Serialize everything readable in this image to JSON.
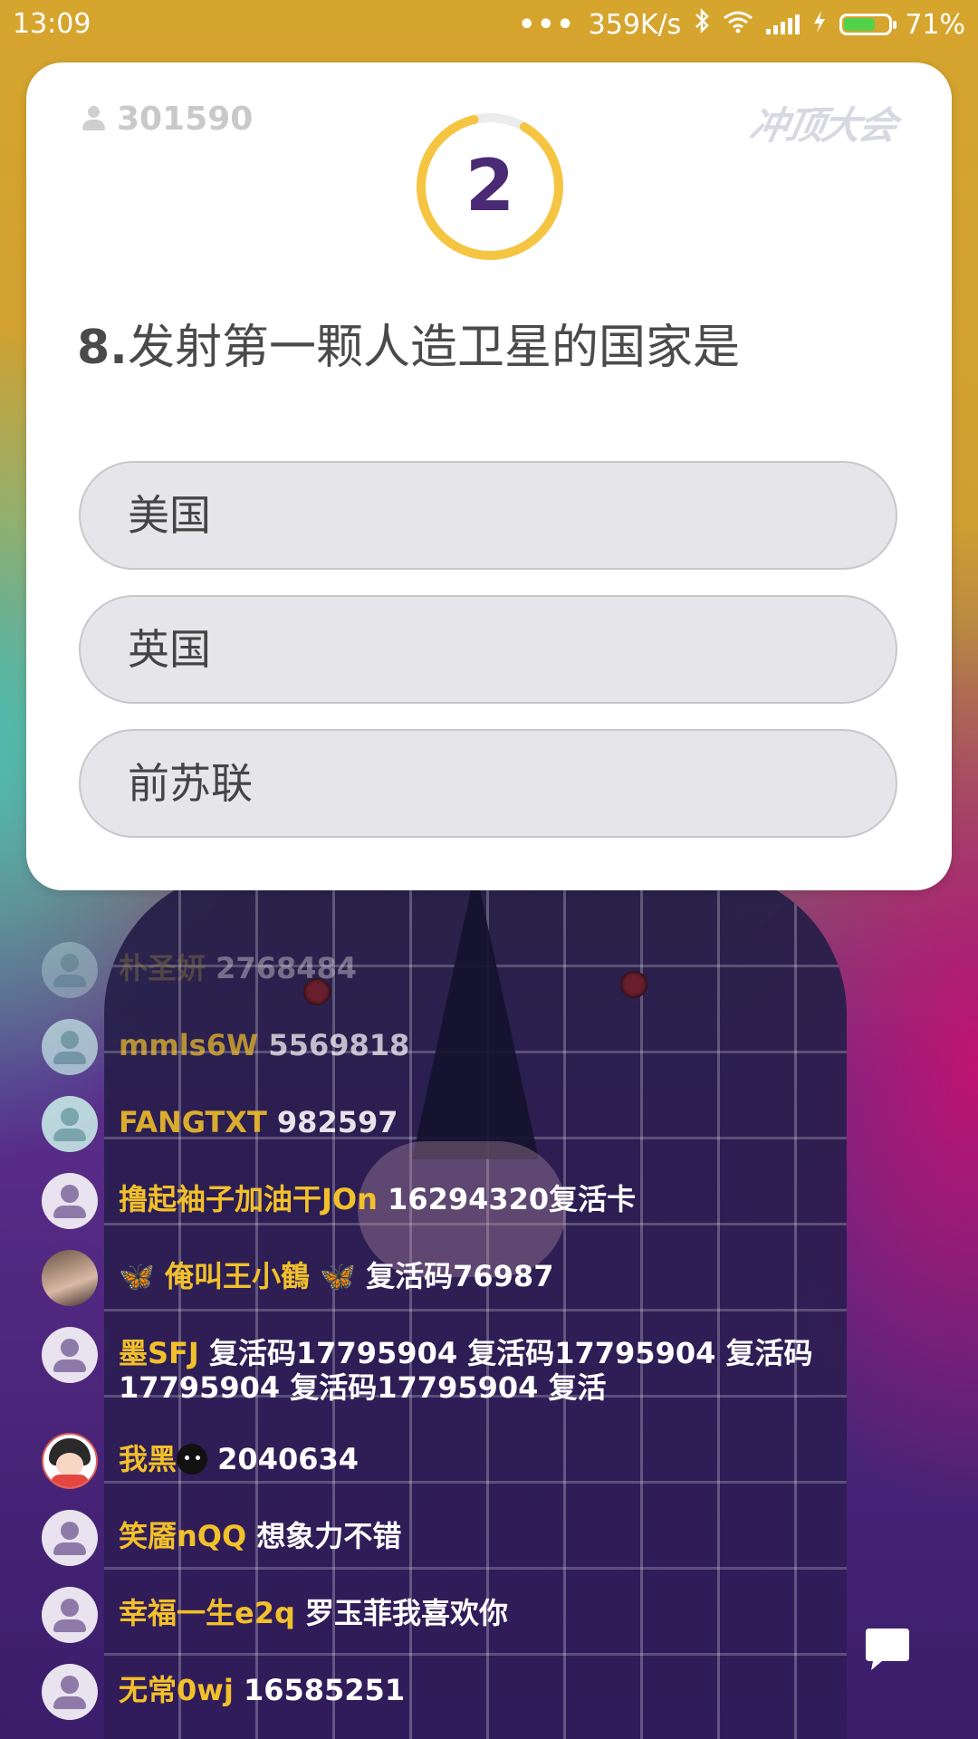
{
  "status_bar": {
    "time": "13:09",
    "network_speed": "359K/s",
    "battery_percent": "71%",
    "battery_level": 0.71,
    "icons": [
      "more-dots-icon",
      "bluetooth-icon",
      "wifi-icon",
      "signal-icon",
      "charging-icon",
      "battery-icon"
    ]
  },
  "quiz": {
    "viewer_count": "301590",
    "logo_text": "冲顶大会",
    "countdown": "2",
    "question_number": "8.",
    "question_text": "发射第一颗人造卫星的国家是",
    "options": [
      "美国",
      "英国",
      "前苏联"
    ],
    "colors": {
      "timer_ring": "#f5c542",
      "timer_number": "#4a2a74",
      "option_bg": "#e6e5e9"
    }
  },
  "comments": [
    {
      "user": "朴圣妍",
      "message": "2768484",
      "avatar": "default"
    },
    {
      "user": "mmls6W",
      "message": "5569818",
      "avatar": "default"
    },
    {
      "user": "FANGTXT",
      "message": "982597",
      "avatar": "default"
    },
    {
      "user": "撸起袖子加油干JOn",
      "message": "16294320复活卡",
      "avatar": "default"
    },
    {
      "user": "🦋 俺叫王小鶴 🦋",
      "message": "复活码76987",
      "avatar": "photo"
    },
    {
      "user": "墨SFJ",
      "message": "复活码17795904 复活码17795904 复活码17795904 复活码17795904 复活",
      "avatar": "default"
    },
    {
      "user": "我黑",
      "message": "2040634",
      "avatar": "cartoon"
    },
    {
      "user": "笑靥nQQ",
      "message": "想象力不错",
      "avatar": "default"
    },
    {
      "user": "幸福一生e2q",
      "message": "罗玉菲我喜欢你",
      "avatar": "default"
    },
    {
      "user": "无常0wj",
      "message": "16585251",
      "avatar": "default"
    }
  ],
  "chat_button_icon": "chat-bubble-icon"
}
